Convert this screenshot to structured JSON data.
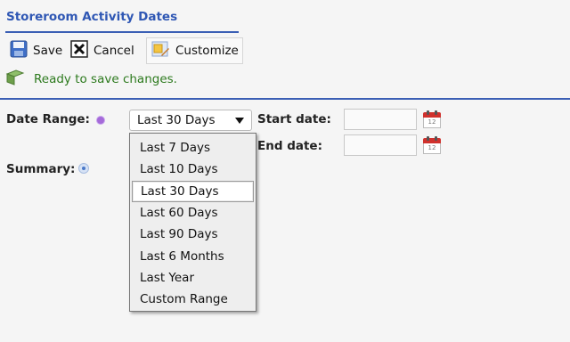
{
  "header": {
    "title": "Storeroom Activity Dates"
  },
  "toolbar": {
    "save_label": "Save",
    "cancel_label": "Cancel",
    "customize_label": "Customize"
  },
  "status": {
    "message": "Ready to save changes."
  },
  "form": {
    "date_range_label": "Date Range:",
    "date_range_value": "Last 30 Days",
    "summary_label": "Summary:",
    "start_date_label": "Start date:",
    "start_date_value": "",
    "end_date_label": "End date:",
    "end_date_value": "",
    "calendar_day": "12"
  },
  "dropdown": {
    "options": [
      "Last 7 Days",
      "Last 10 Days",
      "Last 30 Days",
      "Last 60 Days",
      "Last 90 Days",
      "Last 6 Months",
      "Last Year",
      "Custom Range"
    ],
    "selected": "Last 30 Days"
  },
  "colors": {
    "accent": "#2f57b4",
    "status_green": "#2d7a1e",
    "calendar_red": "#d0312d"
  }
}
